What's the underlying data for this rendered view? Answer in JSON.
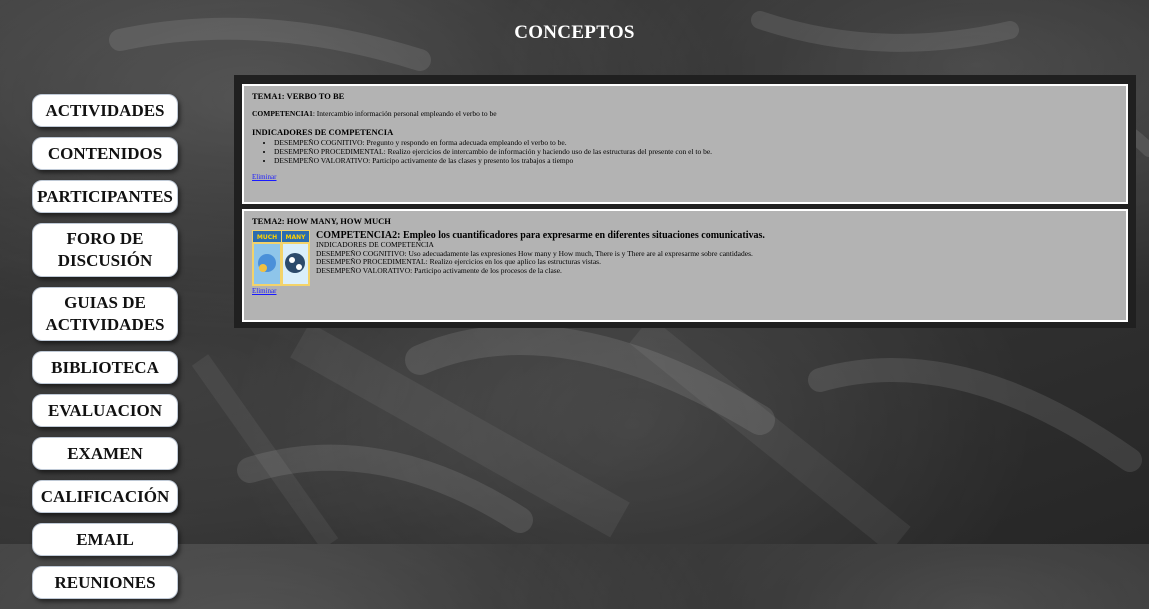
{
  "page": {
    "title": "CONCEPTOS"
  },
  "sidebar": {
    "items": [
      {
        "label": "ACTIVIDADES"
      },
      {
        "label": "CONTENIDOS"
      },
      {
        "label": "PARTICIPANTES"
      },
      {
        "label": "FORO DE DISCUSIÓN"
      },
      {
        "label": "GUIAS DE ACTIVIDADES"
      },
      {
        "label": "BIBLIOTECA"
      },
      {
        "label": "EVALUACION"
      },
      {
        "label": "EXAMEN"
      },
      {
        "label": "CALIFICACIÓN"
      },
      {
        "label": "EMAIL"
      },
      {
        "label": "REUNIONES"
      }
    ]
  },
  "temas": [
    {
      "title": "TEMA1: VERBO TO BE",
      "competencia_label": "COMPETENCIA1",
      "competencia_text": ": Intercambio información personal empleando el verbo to be",
      "indicadores_title": "INDICADORES DE COMPETENCIA",
      "indicadores": [
        "DESEMPEÑO COGNITIVO: Pregunto y respondo en forma adecuada empleando el verbo to be.",
        "DESEMPEÑO PROCEDIMENTAL: Realizo ejercicios de intercambio de información y haciendo uso de las estructuras del presente con el to be.",
        "DESEMPEÑO VALORATIVO: Participo activamente de las clases y presento los trabajos a tiempo"
      ],
      "delete_label": "Eliminar"
    },
    {
      "title": "TEMA2: HOW MANY, HOW MUCH",
      "competencia_title": "COMPETENCIA2: Empleo los cuantificadores para expresarme en diferentes situaciones comunicativas.",
      "indicadores_title": "INDICADORES DE COMPETENCIA",
      "lines": [
        "DESEMPEÑO COGNITIVO: Uso adecuadamente las expresiones How many y How much, There is y There are al expresarme sobre cantidades.",
        "DESEMPEÑO PROCEDIMENTAL: Realizo ejercicios en los que aplico las estructuras vistas.",
        "DESEMPEÑO VALORATIVO: Participo activamente de los procesos de la clase."
      ],
      "image_labels": [
        "MUCH",
        "MANY"
      ],
      "delete_label": "Eliminar"
    }
  ],
  "colors": {
    "background": "#2e2e2e",
    "panel": "#b3b3b3",
    "panel_border": "#ffffff",
    "link": "#1a1aff",
    "button_bg": "#ffffff"
  }
}
